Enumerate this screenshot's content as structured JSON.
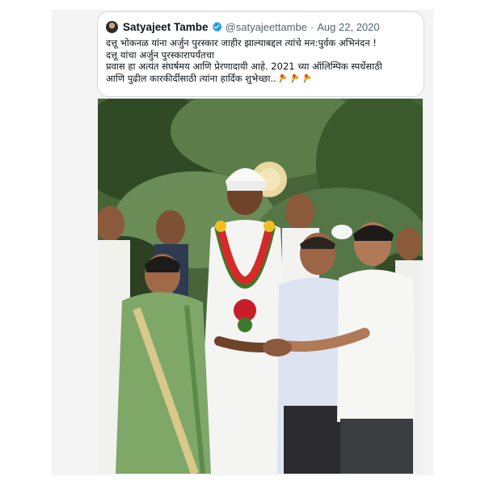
{
  "tweet": {
    "author_name": "Satyajeet Tambe",
    "handle": "@satyajeettambe",
    "separator": "·",
    "date": "Aug 22, 2020",
    "lines": [
      "दत्तू भोकनळ यांना अर्जुन पुरस्कार जाहीर झाल्याबद्दल त्यांचे मन:पुर्वक अभिनंदन !",
      "दत्तू यांचा अर्जुन पुरस्कारापर्यंतचा",
      "प्रवास हा अत्यंत संघर्षमय आणि प्रेरणादायी आहे. 2021 च्या ऑलिम्पिक स्पर्धेसाठी",
      "आणि पुढील कारकीर्दीसाठी त्यांना हार्दिक शुभेच्छा.."
    ]
  },
  "icons": {
    "avatar": "profile-avatar",
    "verified": "verified-badge-icon",
    "flowers": "bouquet-emoji"
  },
  "colors": {
    "verified_blue": "#1d9bf0",
    "text_primary": "#0f1419",
    "text_secondary": "#536471",
    "card_border": "#cfd9de"
  }
}
